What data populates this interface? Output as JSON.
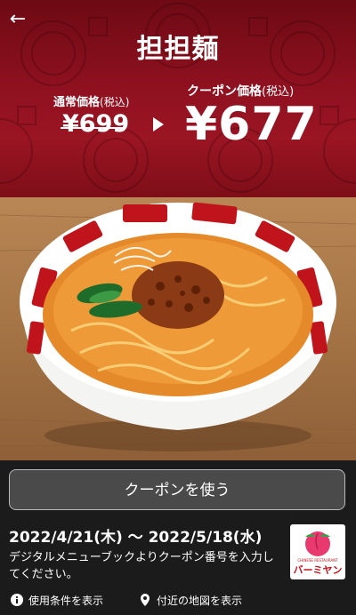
{
  "header": {
    "title": "担担麺",
    "regular_label": "通常価格",
    "regular_tax": "(税込)",
    "regular_price": "¥699",
    "coupon_label": "クーポン価格",
    "coupon_tax": "(税込)",
    "coupon_price": "¥677"
  },
  "action": {
    "use_button": "クーポンを使う"
  },
  "validity": {
    "dates": "2022/4/21(木) ～ 2022/5/18(水)",
    "description": "デジタルメニューブックよりクーポン番号を入力してください。"
  },
  "logo": {
    "small_text": "CHINESE RESTAURANT",
    "brand": "バーミヤン"
  },
  "links": {
    "terms": "使用条件を表示",
    "map": "付近の地図を表示"
  },
  "colors": {
    "header_red": "#8f1120",
    "panel_bg": "#1b1b1b",
    "logo_peach": "#e83a6e",
    "logo_green": "#3aa347"
  }
}
